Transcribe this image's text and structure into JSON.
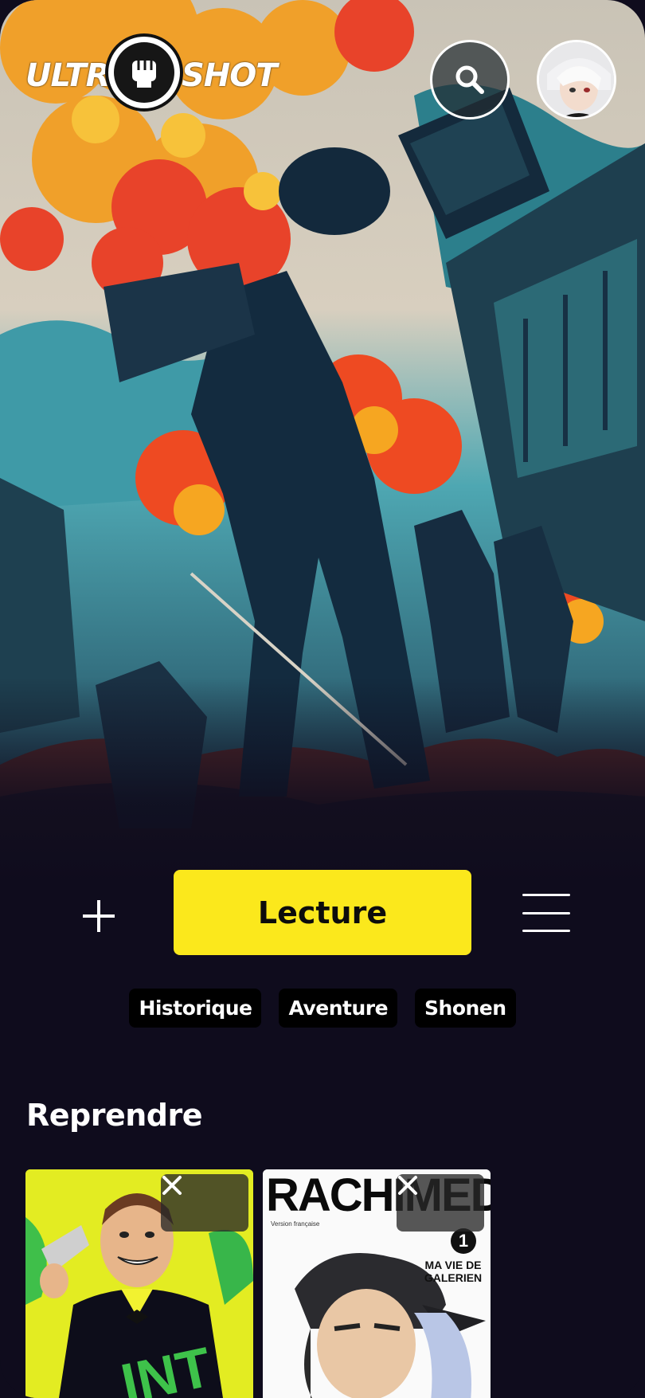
{
  "app": {
    "logo_left": "ULTRA",
    "logo_right": "SHOT"
  },
  "header": {
    "search_icon": "search-icon",
    "avatar_alt": "user-avatar"
  },
  "actions": {
    "add_icon": "plus-icon",
    "read_label": "Lecture",
    "menu_icon": "menu-icon",
    "accent": "#fbe81c"
  },
  "tags": [
    {
      "label": "Historique"
    },
    {
      "label": "Aventure"
    },
    {
      "label": "Shonen"
    }
  ],
  "resume": {
    "title": "Reprendre",
    "items": [
      {
        "close_icon": "close-icon",
        "cover": "comic-cover-1"
      },
      {
        "close_icon": "close-icon",
        "cover": "comic-cover-2",
        "cover_title": "RACHIMED",
        "cover_subtitle": "Version française",
        "volume": "1",
        "tagline": "MA VIE DE GALERIEN"
      }
    ]
  },
  "colors": {
    "background": "#0f0c1d",
    "tag_bg": "#000000"
  }
}
